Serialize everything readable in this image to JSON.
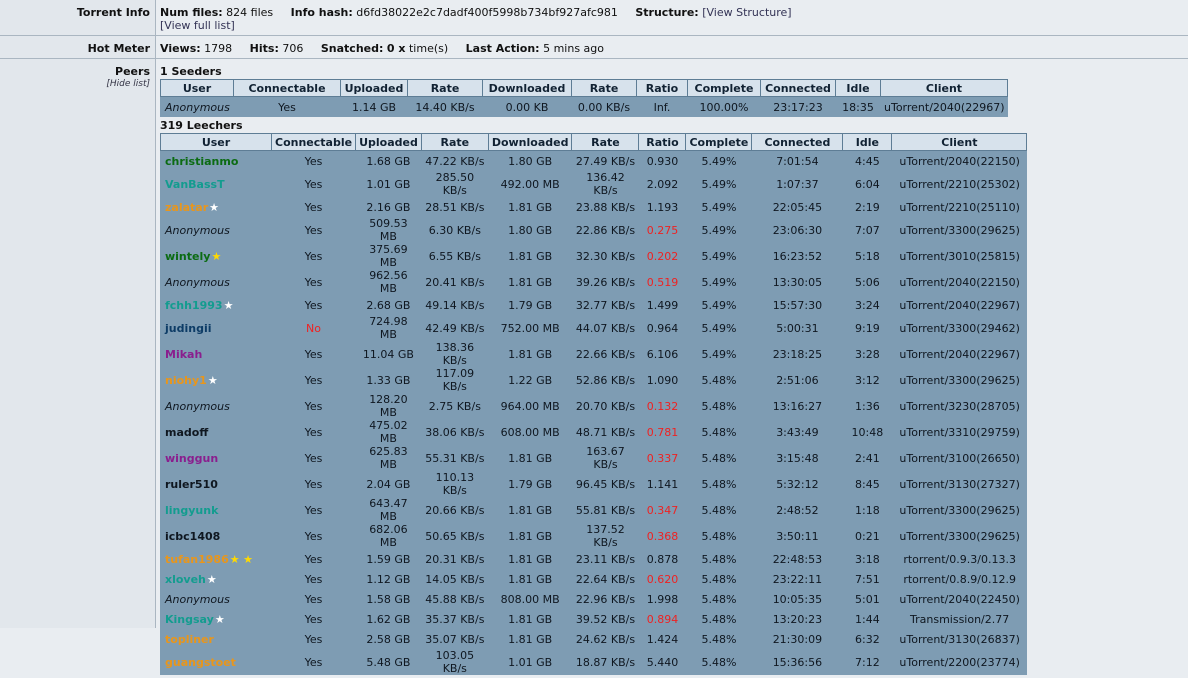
{
  "torrent_info": {
    "label": "Torrent Info",
    "num_files_label": "Num files:",
    "num_files_value": "824 files",
    "info_hash_label": "Info hash:",
    "info_hash_value": "d6fd38022e2c7dadf400f5998b734bf927afc981",
    "structure_label": "Structure:",
    "structure_link": "[View Structure]",
    "full_list_link": "[View full list]"
  },
  "hot_meter": {
    "label": "Hot Meter",
    "views_label": "Views:",
    "views_value": "1798",
    "hits_label": "Hits:",
    "hits_value": "706",
    "snatched_label": "Snatched:",
    "snatched_value": "0 x",
    "snatched_suffix": "time(s)",
    "last_action_label": "Last Action:",
    "last_action_value": "5 mins ago"
  },
  "peers": {
    "label": "Peers",
    "hide_link": "[Hide list]",
    "seeders_title": "1 Seeders",
    "leechers_title": "319 Leechers",
    "columns": [
      "User",
      "Connectable",
      "Uploaded",
      "Rate",
      "Downloaded",
      "Rate",
      "Ratio",
      "Complete",
      "Connected",
      "Idle",
      "Client"
    ],
    "seeders": [
      {
        "user": "Anonymous",
        "color": "#0f1720",
        "anon": true,
        "stars": "",
        "conn": "Yes",
        "up": "1.14 GB",
        "uprate": "14.40 KB/s",
        "down": "0.00 KB",
        "downrate": "0.00 KB/s",
        "ratio": "Inf.",
        "ratio_red": false,
        "complete": "100.00%",
        "connected": "23:17:23",
        "idle": "18:35",
        "client": "uTorrent/2040(22967)"
      }
    ],
    "leechers": [
      {
        "user": "christianmo",
        "color": "#0b6b12",
        "anon": false,
        "stars": "",
        "conn": "Yes",
        "up": "1.68 GB",
        "uprate": "47.22 KB/s",
        "down": "1.80 GB",
        "downrate": "27.49 KB/s",
        "ratio": "0.930",
        "ratio_red": false,
        "complete": "5.49%",
        "connected": "7:01:54",
        "idle": "4:45",
        "client": "uTorrent/2040(22150)"
      },
      {
        "user": "VanBassT",
        "color": "#139c8f",
        "anon": false,
        "stars": "",
        "conn": "Yes",
        "up": "1.01 GB",
        "uprate": "285.50 KB/s",
        "down": "492.00 MB",
        "downrate": "136.42 KB/s",
        "ratio": "2.092",
        "ratio_red": false,
        "complete": "5.49%",
        "connected": "1:07:37",
        "idle": "6:04",
        "client": "uTorrent/2210(25302)"
      },
      {
        "user": "zalatar",
        "color": "#e8961c",
        "anon": false,
        "stars": "★",
        "conn": "Yes",
        "up": "2.16 GB",
        "uprate": "28.51 KB/s",
        "down": "1.81 GB",
        "downrate": "23.88 KB/s",
        "ratio": "1.193",
        "ratio_red": false,
        "complete": "5.49%",
        "connected": "22:05:45",
        "idle": "2:19",
        "client": "uTorrent/2210(25110)"
      },
      {
        "user": "Anonymous",
        "color": "#0f1720",
        "anon": true,
        "stars": "",
        "conn": "Yes",
        "up": "509.53 MB",
        "uprate": "6.30 KB/s",
        "down": "1.80 GB",
        "downrate": "22.86 KB/s",
        "ratio": "0.275",
        "ratio_red": true,
        "complete": "5.49%",
        "connected": "23:06:30",
        "idle": "7:07",
        "client": "uTorrent/3300(29625)"
      },
      {
        "user": "wintely",
        "color": "#0b6b12",
        "anon": false,
        "stars": "★",
        "stars_yellow": true,
        "conn": "Yes",
        "up": "375.69 MB",
        "uprate": "6.55 KB/s",
        "down": "1.81 GB",
        "downrate": "32.30 KB/s",
        "ratio": "0.202",
        "ratio_red": true,
        "complete": "5.49%",
        "connected": "16:23:52",
        "idle": "5:18",
        "client": "uTorrent/3010(25815)"
      },
      {
        "user": "Anonymous",
        "color": "#0f1720",
        "anon": true,
        "stars": "",
        "conn": "Yes",
        "up": "962.56 MB",
        "uprate": "20.41 KB/s",
        "down": "1.81 GB",
        "downrate": "39.26 KB/s",
        "ratio": "0.519",
        "ratio_red": true,
        "complete": "5.49%",
        "connected": "13:30:05",
        "idle": "5:06",
        "client": "uTorrent/2040(22150)"
      },
      {
        "user": "fchh1993",
        "color": "#139c8f",
        "anon": false,
        "stars": "★",
        "conn": "Yes",
        "up": "2.68 GB",
        "uprate": "49.14 KB/s",
        "down": "1.79 GB",
        "downrate": "32.77 KB/s",
        "ratio": "1.499",
        "ratio_red": false,
        "complete": "5.49%",
        "connected": "15:57:30",
        "idle": "3:24",
        "client": "uTorrent/2040(22967)"
      },
      {
        "user": "judingii",
        "color": "#0d3c66",
        "anon": false,
        "stars": "",
        "conn": "No",
        "conn_red": true,
        "up": "724.98 MB",
        "uprate": "42.49 KB/s",
        "down": "752.00 MB",
        "downrate": "44.07 KB/s",
        "ratio": "0.964",
        "ratio_red": false,
        "complete": "5.49%",
        "connected": "5:00:31",
        "idle": "9:19",
        "client": "uTorrent/3300(29462)"
      },
      {
        "user": "Mikah",
        "color": "#8a1e8e",
        "anon": false,
        "stars": "",
        "conn": "Yes",
        "up": "11.04 GB",
        "uprate": "138.36 KB/s",
        "down": "1.81 GB",
        "downrate": "22.66 KB/s",
        "ratio": "6.106",
        "ratio_red": false,
        "complete": "5.49%",
        "connected": "23:18:25",
        "idle": "3:28",
        "client": "uTorrent/2040(22967)"
      },
      {
        "user": "niohy1",
        "color": "#e8961c",
        "anon": false,
        "stars": "★",
        "conn": "Yes",
        "up": "1.33 GB",
        "uprate": "117.09 KB/s",
        "down": "1.22 GB",
        "downrate": "52.86 KB/s",
        "ratio": "1.090",
        "ratio_red": false,
        "complete": "5.48%",
        "connected": "2:51:06",
        "idle": "3:12",
        "client": "uTorrent/3300(29625)"
      },
      {
        "user": "Anonymous",
        "color": "#0f1720",
        "anon": true,
        "stars": "",
        "conn": "Yes",
        "up": "128.20 MB",
        "uprate": "2.75 KB/s",
        "down": "964.00 MB",
        "downrate": "20.70 KB/s",
        "ratio": "0.132",
        "ratio_red": true,
        "complete": "5.48%",
        "connected": "13:16:27",
        "idle": "1:36",
        "client": "uTorrent/3230(28705)"
      },
      {
        "user": "madoff",
        "color": "#0f1720",
        "anon": false,
        "stars": "",
        "conn": "Yes",
        "up": "475.02 MB",
        "uprate": "38.06 KB/s",
        "down": "608.00 MB",
        "downrate": "48.71 KB/s",
        "ratio": "0.781",
        "ratio_red": true,
        "complete": "5.48%",
        "connected": "3:43:49",
        "idle": "10:48",
        "client": "uTorrent/3310(29759)"
      },
      {
        "user": "winggun",
        "color": "#8a1e8e",
        "anon": false,
        "stars": "",
        "conn": "Yes",
        "up": "625.83 MB",
        "uprate": "55.31 KB/s",
        "down": "1.81 GB",
        "downrate": "163.67 KB/s",
        "ratio": "0.337",
        "ratio_red": true,
        "complete": "5.48%",
        "connected": "3:15:48",
        "idle": "2:41",
        "client": "uTorrent/3100(26650)"
      },
      {
        "user": "ruler510",
        "color": "#0f1720",
        "anon": false,
        "stars": "",
        "conn": "Yes",
        "up": "2.04 GB",
        "uprate": "110.13 KB/s",
        "down": "1.79 GB",
        "downrate": "96.45 KB/s",
        "ratio": "1.141",
        "ratio_red": false,
        "complete": "5.48%",
        "connected": "5:32:12",
        "idle": "8:45",
        "client": "uTorrent/3130(27327)"
      },
      {
        "user": "lingyunk",
        "color": "#139c8f",
        "anon": false,
        "stars": "",
        "conn": "Yes",
        "up": "643.47 MB",
        "uprate": "20.66 KB/s",
        "down": "1.81 GB",
        "downrate": "55.81 KB/s",
        "ratio": "0.347",
        "ratio_red": true,
        "complete": "5.48%",
        "connected": "2:48:52",
        "idle": "1:18",
        "client": "uTorrent/3300(29625)"
      },
      {
        "user": "icbc1408",
        "color": "#0f1720",
        "anon": false,
        "stars": "",
        "conn": "Yes",
        "up": "682.06 MB",
        "uprate": "50.65 KB/s",
        "down": "1.81 GB",
        "downrate": "137.52 KB/s",
        "ratio": "0.368",
        "ratio_red": true,
        "complete": "5.48%",
        "connected": "3:50:11",
        "idle": "0:21",
        "client": "uTorrent/3300(29625)"
      },
      {
        "user": "tufan1986",
        "color": "#e8961c",
        "anon": false,
        "stars": "★ ★",
        "stars_yellow": true,
        "conn": "Yes",
        "up": "1.59 GB",
        "uprate": "20.31 KB/s",
        "down": "1.81 GB",
        "downrate": "23.11 KB/s",
        "ratio": "0.878",
        "ratio_red": false,
        "complete": "5.48%",
        "connected": "22:48:53",
        "idle": "3:18",
        "client": "rtorrent/0.9.3/0.13.3"
      },
      {
        "user": "xloveh",
        "color": "#139c8f",
        "anon": false,
        "stars": "★",
        "conn": "Yes",
        "up": "1.12 GB",
        "uprate": "14.05 KB/s",
        "down": "1.81 GB",
        "downrate": "22.64 KB/s",
        "ratio": "0.620",
        "ratio_red": true,
        "complete": "5.48%",
        "connected": "23:22:11",
        "idle": "7:51",
        "client": "rtorrent/0.8.9/0.12.9"
      },
      {
        "user": "Anonymous",
        "color": "#0f1720",
        "anon": true,
        "stars": "",
        "conn": "Yes",
        "up": "1.58 GB",
        "uprate": "45.88 KB/s",
        "down": "808.00 MB",
        "downrate": "22.96 KB/s",
        "ratio": "1.998",
        "ratio_red": false,
        "complete": "5.48%",
        "connected": "10:05:35",
        "idle": "5:01",
        "client": "uTorrent/2040(22450)"
      },
      {
        "user": "Kingsay",
        "color": "#139c8f",
        "anon": false,
        "stars": "★",
        "conn": "Yes",
        "up": "1.62 GB",
        "uprate": "35.37 KB/s",
        "down": "1.81 GB",
        "downrate": "39.52 KB/s",
        "ratio": "0.894",
        "ratio_red": true,
        "complete": "5.48%",
        "connected": "13:20:23",
        "idle": "1:44",
        "client": "Transmission/2.77"
      },
      {
        "user": "topliner",
        "color": "#e8961c",
        "anon": false,
        "stars": "",
        "conn": "Yes",
        "up": "2.58 GB",
        "uprate": "35.07 KB/s",
        "down": "1.81 GB",
        "downrate": "24.62 KB/s",
        "ratio": "1.424",
        "ratio_red": false,
        "complete": "5.48%",
        "connected": "21:30:09",
        "idle": "6:32",
        "client": "uTorrent/3130(26837)"
      },
      {
        "user": "guangstoet",
        "color": "#e8961c",
        "anon": false,
        "stars": "",
        "conn": "Yes",
        "up": "5.48 GB",
        "uprate": "103.05 KB/s",
        "down": "1.01 GB",
        "downrate": "18.87 KB/s",
        "ratio": "5.440",
        "ratio_red": false,
        "complete": "5.48%",
        "connected": "15:36:56",
        "idle": "7:12",
        "client": "uTorrent/2200(23774)"
      }
    ]
  }
}
